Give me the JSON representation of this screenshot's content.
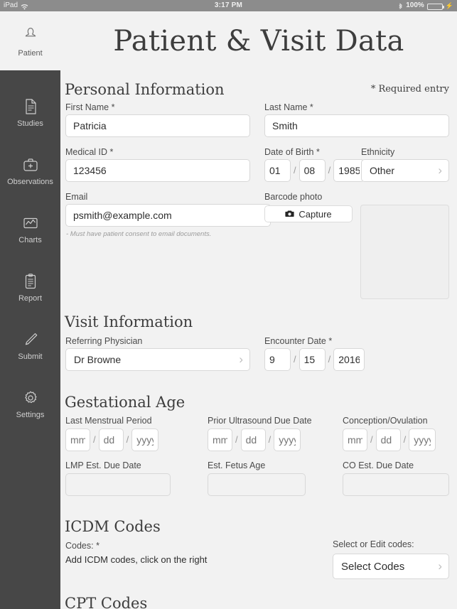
{
  "status_bar": {
    "device": "iPad",
    "wifi_icon": "wifi-icon",
    "time": "3:17 PM",
    "bluetooth_icon": "bluetooth-icon",
    "battery_percent": "100%",
    "battery_icon": "battery-full-icon",
    "charging_icon": "lightning-bolt-icon"
  },
  "header": {
    "title": "Patient & Visit Data",
    "patient_tab_label": "Patient",
    "patient_tab_icon": "person-icon"
  },
  "sidebar": {
    "items": [
      {
        "label": "Studies",
        "icon": "document-icon"
      },
      {
        "label": "Observations",
        "icon": "medical-bag-icon"
      },
      {
        "label": "Charts",
        "icon": "line-chart-icon"
      },
      {
        "label": "Report",
        "icon": "clipboard-icon"
      },
      {
        "label": "Submit",
        "icon": "pencil-icon"
      },
      {
        "label": "Settings",
        "icon": "gear-icon"
      }
    ]
  },
  "personal_information": {
    "section_title": "Personal Information",
    "required_note": "* Required entry",
    "first_name": {
      "label": "First Name *",
      "value": "Patricia"
    },
    "last_name": {
      "label": "Last Name *",
      "value": "Smith"
    },
    "medical_id": {
      "label": "Medical ID *",
      "value": "123456"
    },
    "date_of_birth": {
      "label": "Date of Birth *",
      "month": "01",
      "day": "08",
      "year": "1985",
      "separator": "/"
    },
    "ethnicity": {
      "label": "Ethnicity",
      "value": "Other",
      "chevron": "chevron-right-icon"
    },
    "email": {
      "label": "Email",
      "value": "psmith@example.com"
    },
    "email_hint": "- Must have patient consent to email documents.",
    "barcode_photo": {
      "label": "Barcode photo",
      "capture_label": "Capture",
      "capture_icon": "camera-icon"
    }
  },
  "visit_information": {
    "section_title": "Visit Information",
    "referring_physician": {
      "label": "Referring Physician",
      "value": "Dr Browne",
      "chevron": "chevron-right-icon"
    },
    "encounter_date": {
      "label": "Encounter Date *",
      "month": "9",
      "day": "15",
      "year": "2016",
      "separator": "/"
    }
  },
  "gestational_age": {
    "section_title": "Gestational Age",
    "last_menstrual_period": {
      "label": "Last Menstrual Period",
      "mm": "mm",
      "dd": "dd",
      "yyyy": "yyyy",
      "separator": "/"
    },
    "prior_ultrasound_due_date": {
      "label": "Prior Ultrasound Due Date",
      "mm": "mm",
      "dd": "dd",
      "yyyy": "yyyy",
      "separator": "/"
    },
    "conception_ovulation": {
      "label": "Conception/Ovulation",
      "mm": "mm",
      "dd": "dd",
      "yyyy": "yyyy",
      "separator": "/"
    },
    "lmp_est_due_date": {
      "label": "LMP Est. Due Date",
      "value": ""
    },
    "est_fetus_age": {
      "label": "Est. Fetus Age",
      "value": ""
    },
    "co_est_due_date": {
      "label": "CO Est. Due Date",
      "value": ""
    }
  },
  "icdm_codes": {
    "section_title": "ICDM Codes",
    "codes_label": "Codes: *",
    "codes_instruction": "Add ICDM codes, click on the right",
    "select_edit_label": "Select or Edit codes:",
    "select_button": {
      "value": "Select Codes",
      "chevron": "chevron-right-icon"
    }
  },
  "cpt_codes": {
    "section_title": "CPT Codes"
  },
  "colors": {
    "sidebar_bg": "#474747",
    "page_bg": "#f2f2f2",
    "statusbar_bg": "#8c8c8c",
    "battery_green": "#3ddc5c",
    "input_border": "#d8d8d8"
  }
}
